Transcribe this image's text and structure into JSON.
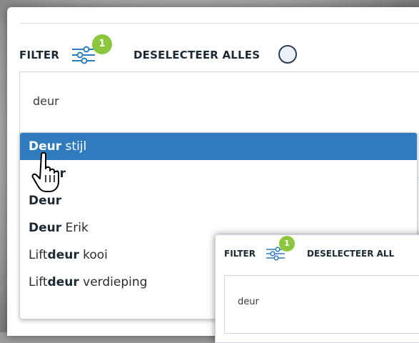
{
  "filter": {
    "label": "FILTER",
    "badge_count": "1",
    "deselect_label": "DESELECTEER ALLES",
    "search_value": "deur"
  },
  "options": [
    {
      "bold": "Deur",
      "rest": " stijl",
      "prefix": ""
    },
    {
      "bold": "eur",
      "rest": "",
      "prefix": ""
    },
    {
      "bold": "Deur",
      "rest": "",
      "prefix": ""
    },
    {
      "bold": "Deur",
      "rest": " Erik",
      "prefix": ""
    },
    {
      "bold": "deur",
      "rest": " kooi",
      "prefix": "Lift"
    },
    {
      "bold": "deur",
      "rest": " verdieping",
      "prefix": "Lift"
    }
  ],
  "inset": {
    "label": "FILTER",
    "badge_count": "1",
    "deselect_label": "DESELECTEER ALL",
    "search_value": "deur"
  },
  "colors": {
    "accent": "#2f7bbd",
    "badge": "#8cc63e",
    "text": "#1d2a33"
  },
  "icons": [
    "filter-sliders-icon",
    "hand-pointer-cursor-icon"
  ]
}
